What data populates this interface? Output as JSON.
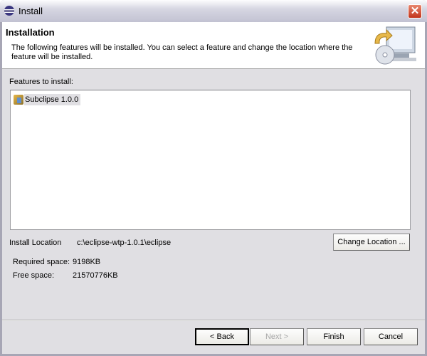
{
  "window": {
    "title": "Install"
  },
  "header": {
    "title": "Installation",
    "description": "The following features will be installed. You can select a feature and change the location where the feature will be installed."
  },
  "features": {
    "label": "Features to install:",
    "items": [
      {
        "label": "Subclipse 1.0.0"
      }
    ]
  },
  "location": {
    "label": "Install Location",
    "value": "c:\\eclipse-wtp-1.0.1\\eclipse",
    "change_button": "Change Location ..."
  },
  "space": {
    "required_label": "Required space:",
    "required_value": "9198KB",
    "free_label": "Free space:",
    "free_value": "21570776KB"
  },
  "buttons": {
    "back": "< Back",
    "next": "Next >",
    "finish": "Finish",
    "cancel": "Cancel"
  }
}
